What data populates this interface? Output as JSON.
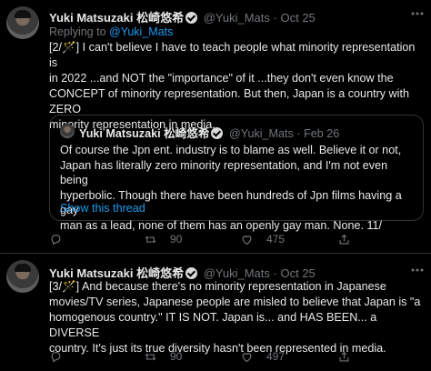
{
  "tweet1": {
    "author": "Yuki Matsuzaki 松崎悠希",
    "handle": "@Yuki_Mats",
    "sep": "·",
    "date": "Oct 25",
    "replying_prefix": "Replying to ",
    "replying_to": "@Yuki_Mats",
    "text": "[2/🪄] I can't believe I have to teach people what minority representation is\nin 2022 ...and NOT the \"importance\" of it ...they don't even know the\nCONCEPT of minority representation. But then, Japan is a country with ZERO\nminority representation in media.",
    "quote": {
      "author": "Yuki Matsuzaki 松崎悠希",
      "handle": "@Yuki_Mats",
      "sep": "·",
      "date": "Feb 26",
      "text": "Of course the Jpn ent. industry is to blame as well. Believe it or not,\nJapan has literally zero minority representation, and I'm not even being\nhyperbolic. Though there have been hundreds of Jpn films having a gay\nman as a lead, none of them has an openly gay man. None. 11/",
      "show_thread": "Show this thread"
    },
    "actions": {
      "replies": "",
      "retweets": "90",
      "likes": "475"
    }
  },
  "tweet2": {
    "author": "Yuki Matsuzaki 松崎悠希",
    "handle": "@Yuki_Mats",
    "sep": "·",
    "date": "Oct 25",
    "text": "[3/🪄] And because there's no minority representation in Japanese\nmovies/TV series, Japanese people are misled to believe that Japan is \"a\nhomogenous country.\" IT IS NOT. Japan is... and HAS BEEN... a DIVERSE\ncountry. It's just its true diversity hasn't been represented in media.",
    "actions": {
      "replies": "",
      "retweets": "90",
      "likes": "497"
    }
  },
  "icons": [
    "more-icon",
    "verified-badge-icon",
    "reply-icon",
    "retweet-icon",
    "like-icon",
    "share-icon"
  ],
  "colors": {
    "background": "#000000",
    "text": "#e7e9ea",
    "muted": "#71767b",
    "link": "#1d9bf0",
    "border": "#2f3336"
  }
}
